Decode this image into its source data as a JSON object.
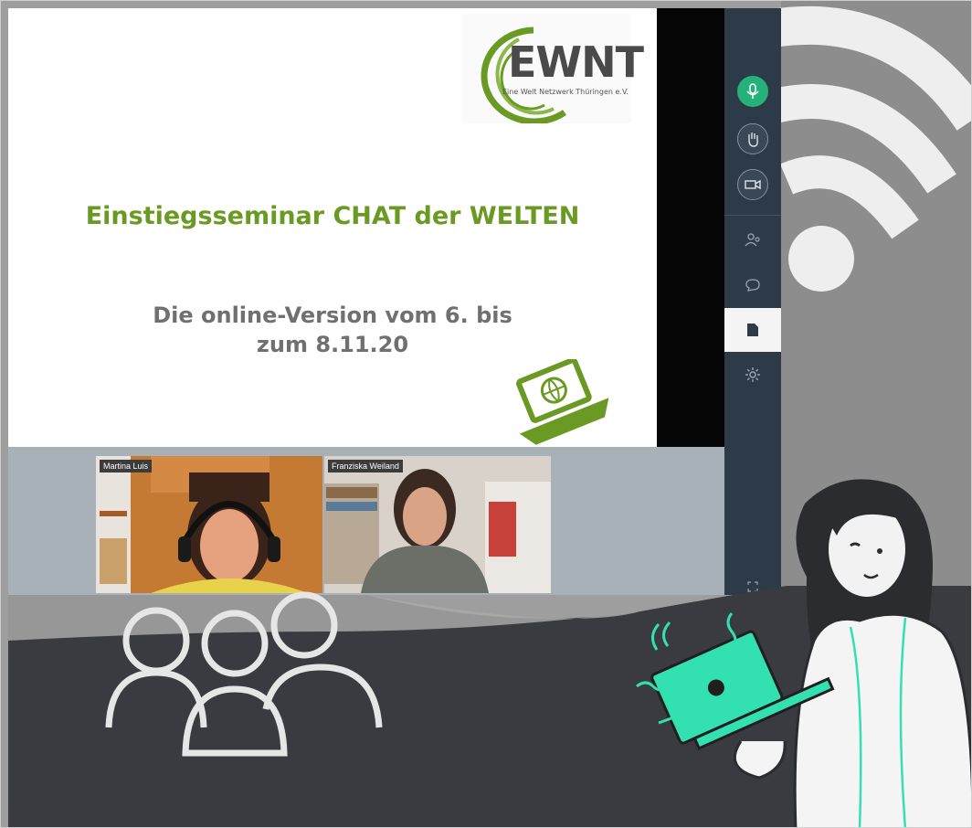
{
  "logo": {
    "text": "EWNT",
    "subtitle": "Eine Welt Netzwerk Thüringen e.V."
  },
  "slide": {
    "title": "Einstiegsseminar CHAT der WELTEN",
    "subtitle_line1": "Die online-Version vom 6. bis",
    "subtitle_line2": "zum 8.11.20"
  },
  "toolbar": {
    "buttons": [
      {
        "icon": "microphone-icon",
        "active": true
      },
      {
        "icon": "raise-hand-icon",
        "active": false
      },
      {
        "icon": "camera-icon",
        "active": false
      }
    ],
    "items": [
      {
        "icon": "participants-icon"
      },
      {
        "icon": "chat-icon"
      },
      {
        "icon": "document-icon",
        "selected": true
      },
      {
        "icon": "settings-icon"
      },
      {
        "icon": "fullscreen-icon"
      }
    ]
  },
  "participants": [
    {
      "name": "Martina Luis"
    },
    {
      "name": "Franziska Weiland"
    }
  ],
  "colors": {
    "accent_green": "#6a9a23",
    "mic_active": "#26b07a",
    "toolbar_bg": "#2d3a47",
    "dark_wave": "#3a3b40",
    "mint": "#33e0b0"
  }
}
